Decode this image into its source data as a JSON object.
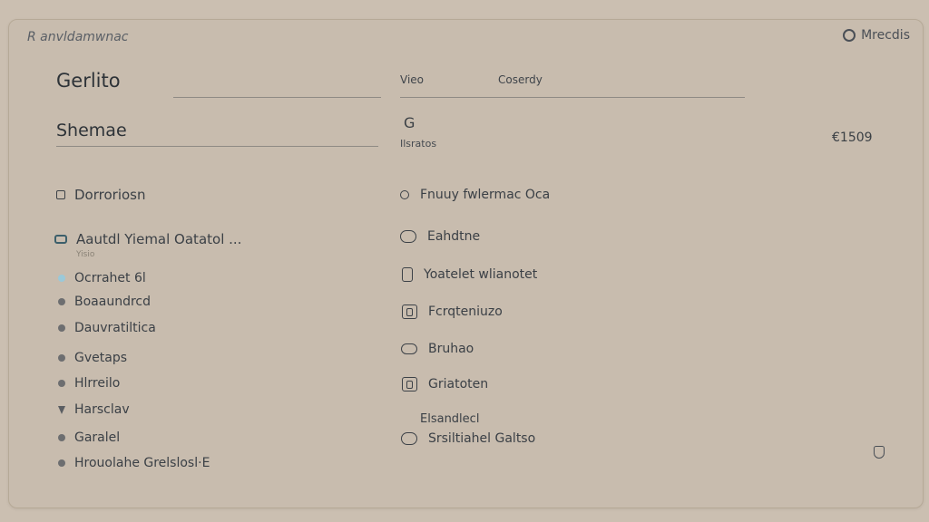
{
  "app": {
    "title": "R anvldamwnac"
  },
  "user": {
    "label": "Mrecdis",
    "icon": "user-circle-icon"
  },
  "left": {
    "heading1": "Gerlito",
    "heading2": "Shemae",
    "section_label": "Dorroriosn",
    "folder_label": "Aautdl Yiemal Oatatol ...",
    "folder_hint": "Yisio",
    "items": [
      {
        "label": "Ocrrahet 6l",
        "icon": "dot-light"
      },
      {
        "label": "Boaaundrcd",
        "icon": "dot"
      },
      {
        "label": "Dauvratiltica",
        "icon": "dot"
      },
      {
        "label": "Gvetaps",
        "icon": "dot"
      },
      {
        "label": "Hlrreilo",
        "icon": "dot"
      },
      {
        "label": "Harsclav",
        "icon": "triangle"
      },
      {
        "label": "Garalel",
        "icon": "dot"
      },
      {
        "label": "Hrouolahe Grelslosl·E",
        "icon": "dot"
      }
    ]
  },
  "right": {
    "col_head_1": "Vieo",
    "col_head_2": "Coserdy",
    "glyph": "G",
    "sub_label": "Ilsratos",
    "amount": "€1509",
    "options": [
      {
        "label": "Fnuuy fwlermac Oca",
        "icon": "radio-icon"
      },
      {
        "label": "Eahdtne",
        "icon": "rounded-icon"
      },
      {
        "label": "Yoatelet wlianotet",
        "icon": "tall-icon"
      },
      {
        "label": "Fcrqteniuzo",
        "icon": "square-icon"
      },
      {
        "label": "Bruhao",
        "icon": "oval-icon"
      },
      {
        "label": "Griatoten",
        "icon": "square-icon"
      },
      {
        "label": "Srsiltiahel Galtso",
        "icon": "rounded-icon"
      }
    ],
    "floating_label": "Elsandlecl"
  }
}
